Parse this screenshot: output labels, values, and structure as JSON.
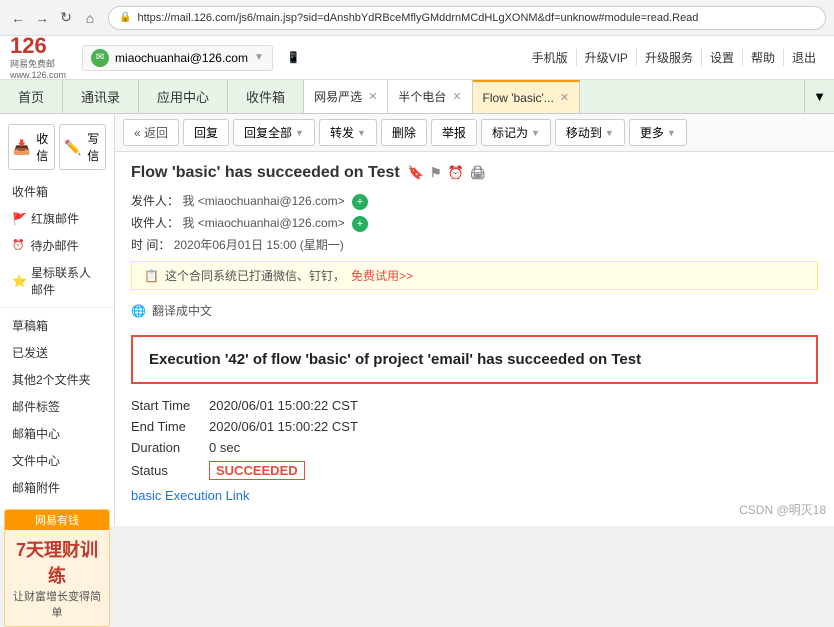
{
  "browser": {
    "url": "https://mail.126.com/js6/main.jsp?sid=dAnshbYdRBceMflyGMddrnMCdHLgXONM&df=unknow#module=read.Read",
    "back_label": "←",
    "forward_label": "→",
    "refresh_label": "↻",
    "home_label": "⌂"
  },
  "header": {
    "logo_126": "126",
    "logo_line1": "网易免费邮",
    "logo_line2": "www.126.com",
    "user_email": "miaochuanhai@126.com",
    "mobile_label": "手机版",
    "upgrade_vip_label": "升级VIP",
    "upgrade_service_label": "升级服务",
    "settings_label": "设置",
    "help_label": "帮助",
    "logout_label": "退出"
  },
  "nav_tabs": [
    {
      "label": "首页",
      "active": false
    },
    {
      "label": "通讯录",
      "active": false
    },
    {
      "label": "应用中心",
      "active": false
    },
    {
      "label": "收件箱",
      "active": false
    },
    {
      "label": "网易严选",
      "active": false,
      "closable": true
    },
    {
      "label": "半个电台",
      "active": false,
      "closable": true
    },
    {
      "label": "Flow 'basic'...",
      "active": true,
      "closable": true
    }
  ],
  "sidebar": {
    "inbox_label": "收信",
    "write_label": "写信",
    "items": [
      {
        "label": "收件箱",
        "id": "inbox"
      },
      {
        "label": "红旗邮件",
        "id": "flag",
        "flag": true
      },
      {
        "label": "待办邮件",
        "id": "todo"
      },
      {
        "label": "星标联系人邮件",
        "id": "star",
        "star": true
      },
      {
        "label": "草稿箱",
        "id": "draft"
      },
      {
        "label": "已发送",
        "id": "sent"
      },
      {
        "label": "其他2个文件夹",
        "id": "folders"
      },
      {
        "label": "邮件标签",
        "id": "tags"
      },
      {
        "label": "邮箱中心",
        "id": "center"
      },
      {
        "label": "文件中心",
        "id": "files"
      },
      {
        "label": "邮箱附件",
        "id": "attachments"
      }
    ],
    "ad": {
      "title": "网易有钱",
      "big_text": "7天理财训练",
      "small_text": "让财富增长变得简单"
    }
  },
  "toolbar": {
    "back_label": "« 返回",
    "reply_label": "回复",
    "reply_all_label": "回复全部",
    "forward_label": "转发",
    "delete_label": "删除",
    "report_label": "举报",
    "mark_as_label": "标记为",
    "move_to_label": "移动到",
    "more_label": "更多"
  },
  "email": {
    "subject": "Flow 'basic' has succeeded on Test",
    "from_label": "发件人：",
    "from_name": "我",
    "from_email": "<miaochuanhai@126.com>",
    "to_label": "收件人：",
    "to_name": "我",
    "to_email": "<miaochuanhai@126.com>",
    "time_label": "时 间：",
    "time_value": "2020年06月01日 15:00 (星期一)",
    "notification_text": "这个合同系统已打通微信、钉钉，",
    "notification_link": "免费试用>>",
    "translate_text": "翻译成中文",
    "main_heading": "Execution '42' of flow 'basic' of project 'email' has succeeded on Test",
    "start_time_label": "Start Time",
    "start_time_value": "2020/06/01 15:00:22 CST",
    "end_time_label": "End Time",
    "end_time_value": "2020/06/01 15:00:22 CST",
    "duration_label": "Duration",
    "duration_value": "0 sec",
    "status_label": "Status",
    "status_value": "SUCCEEDED",
    "execution_link_label": "basic Execution Link"
  },
  "watermark": "CSDN @明灭18"
}
